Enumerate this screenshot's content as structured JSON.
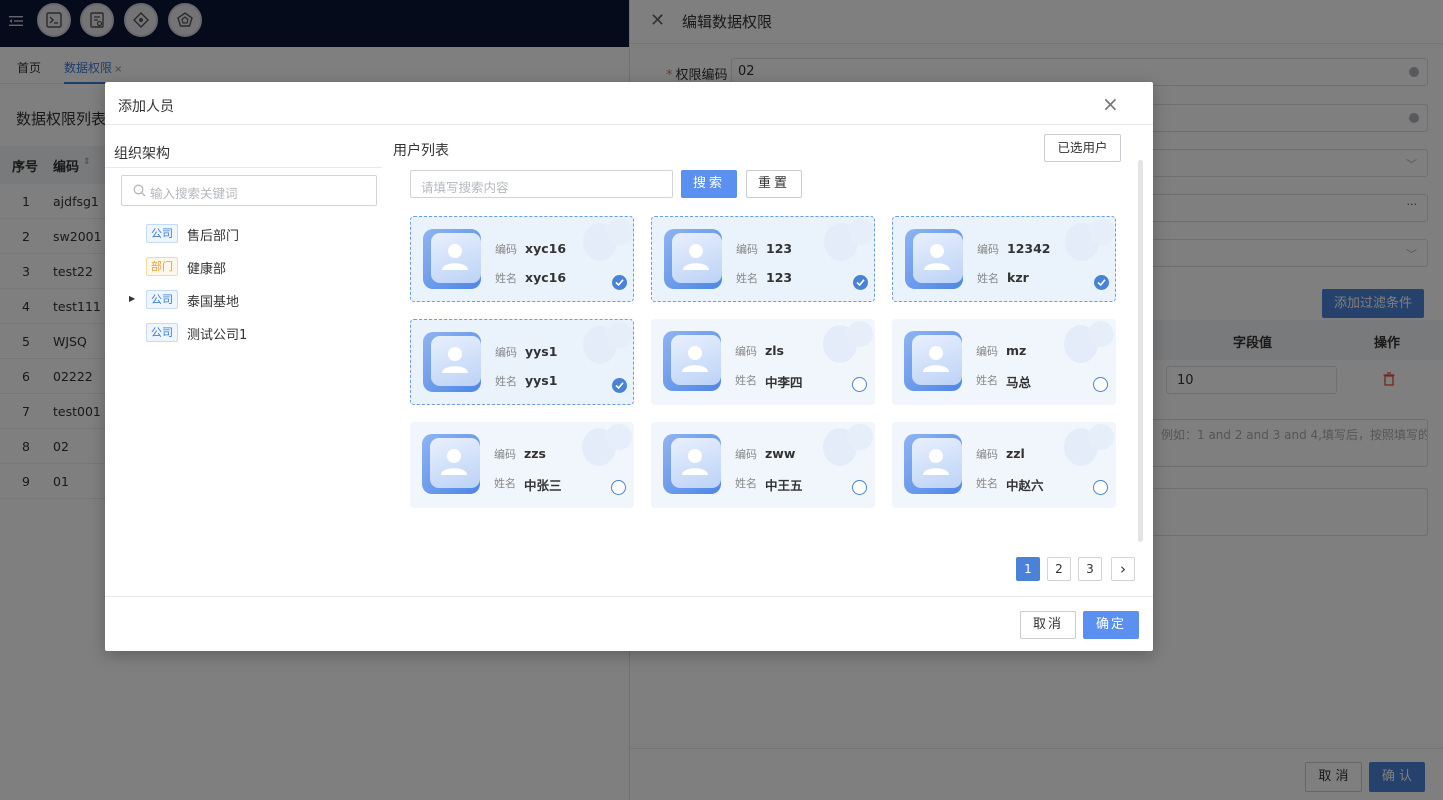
{
  "colors": {
    "primary": "#4a82d8",
    "topbar": "#0d1637",
    "mask": "rgba(0,0,0,0.5)"
  },
  "topbar": {
    "icons": [
      "terminal-icon",
      "document-settings-icon",
      "diamond-nav-icon",
      "pentagon-badge-icon"
    ]
  },
  "tabs": [
    {
      "label": "首页"
    },
    {
      "label": "数据权限",
      "close": "×"
    }
  ],
  "list": {
    "title": "数据权限列表",
    "columns": [
      "序号",
      "编码"
    ],
    "rows": [
      [
        "1",
        "ajdfsg1"
      ],
      [
        "2",
        "sw2001"
      ],
      [
        "3",
        "test22"
      ],
      [
        "4",
        "test111"
      ],
      [
        "5",
        "WJSQ"
      ],
      [
        "6",
        "02222"
      ],
      [
        "7",
        "test001"
      ],
      [
        "8",
        "02"
      ],
      [
        "9",
        "01"
      ]
    ]
  },
  "drawer": {
    "title": "编辑数据权限",
    "code_label": "权限编码",
    "code_value": "02",
    "add_filter_label": "添加过滤条件",
    "filter_columns": [
      "字段值",
      "操作"
    ],
    "filter_value": "10",
    "hint_text": "例如：1 and 2 and 3 and 4,填写后，按照填写的",
    "cancel_label": "取 消",
    "ok_label": "确 认"
  },
  "modal": {
    "title": "添加人员",
    "org": {
      "title": "组织架构",
      "search_placeholder": "输入搜索关键词",
      "items": [
        {
          "tag": "公司",
          "name": "售后部门",
          "type": "company",
          "expandable": false
        },
        {
          "tag": "部门",
          "name": "健康部",
          "type": "dept",
          "expandable": false
        },
        {
          "tag": "公司",
          "name": "泰国基地",
          "type": "company",
          "expandable": true
        },
        {
          "tag": "公司",
          "name": "测试公司1",
          "type": "company",
          "expandable": false
        }
      ]
    },
    "users": {
      "title": "用户列表",
      "selected_label": "已选用户",
      "search_placeholder": "请填写搜索内容",
      "search_label": "搜索",
      "reset_label": "重置",
      "code_label": "编码",
      "name_label": "姓名",
      "cards": [
        {
          "code": "xyc16",
          "name": "xyc16",
          "selected": true
        },
        {
          "code": "123",
          "name": "123",
          "selected": true
        },
        {
          "code": "12342",
          "name": "kzr",
          "selected": true
        },
        {
          "code": "yys1",
          "name": "yys1",
          "selected": true
        },
        {
          "code": "zls",
          "name": "中李四",
          "selected": false
        },
        {
          "code": "mz",
          "name": "马总",
          "selected": false
        },
        {
          "code": "zzs",
          "name": "中张三",
          "selected": false
        },
        {
          "code": "zww",
          "name": "中王五",
          "selected": false
        },
        {
          "code": "zzl",
          "name": "中赵六",
          "selected": false
        }
      ]
    },
    "pagination": {
      "pages": [
        "1",
        "2",
        "3"
      ],
      "current": 1,
      "next": "›"
    },
    "cancel_label": "取消",
    "ok_label": "确定"
  }
}
